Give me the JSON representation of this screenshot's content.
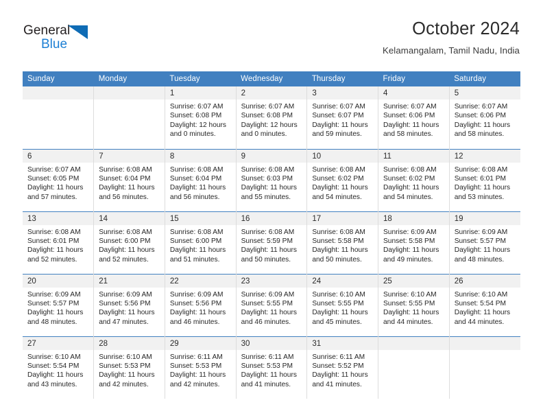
{
  "brand": {
    "name_top": "General",
    "name_bottom": "Blue",
    "triangle_color": "#0f6cb5",
    "text_color": "#1c7fd4"
  },
  "header": {
    "title": "October 2024",
    "subtitle": "Kelamangalam, Tamil Nadu, India"
  },
  "theme": {
    "header_blue": "#4180c0",
    "daynum_band": "#f1f1f1",
    "grid_line": "#dcdcdc"
  },
  "weekdays": [
    "Sunday",
    "Monday",
    "Tuesday",
    "Wednesday",
    "Thursday",
    "Friday",
    "Saturday"
  ],
  "weeks": [
    [
      {
        "day": "",
        "info": ""
      },
      {
        "day": "",
        "info": ""
      },
      {
        "day": "1",
        "info": "Sunrise: 6:07 AM\nSunset: 6:08 PM\nDaylight: 12 hours\nand 0 minutes."
      },
      {
        "day": "2",
        "info": "Sunrise: 6:07 AM\nSunset: 6:08 PM\nDaylight: 12 hours\nand 0 minutes."
      },
      {
        "day": "3",
        "info": "Sunrise: 6:07 AM\nSunset: 6:07 PM\nDaylight: 11 hours\nand 59 minutes."
      },
      {
        "day": "4",
        "info": "Sunrise: 6:07 AM\nSunset: 6:06 PM\nDaylight: 11 hours\nand 58 minutes."
      },
      {
        "day": "5",
        "info": "Sunrise: 6:07 AM\nSunset: 6:06 PM\nDaylight: 11 hours\nand 58 minutes."
      }
    ],
    [
      {
        "day": "6",
        "info": "Sunrise: 6:07 AM\nSunset: 6:05 PM\nDaylight: 11 hours\nand 57 minutes."
      },
      {
        "day": "7",
        "info": "Sunrise: 6:08 AM\nSunset: 6:04 PM\nDaylight: 11 hours\nand 56 minutes."
      },
      {
        "day": "8",
        "info": "Sunrise: 6:08 AM\nSunset: 6:04 PM\nDaylight: 11 hours\nand 56 minutes."
      },
      {
        "day": "9",
        "info": "Sunrise: 6:08 AM\nSunset: 6:03 PM\nDaylight: 11 hours\nand 55 minutes."
      },
      {
        "day": "10",
        "info": "Sunrise: 6:08 AM\nSunset: 6:02 PM\nDaylight: 11 hours\nand 54 minutes."
      },
      {
        "day": "11",
        "info": "Sunrise: 6:08 AM\nSunset: 6:02 PM\nDaylight: 11 hours\nand 54 minutes."
      },
      {
        "day": "12",
        "info": "Sunrise: 6:08 AM\nSunset: 6:01 PM\nDaylight: 11 hours\nand 53 minutes."
      }
    ],
    [
      {
        "day": "13",
        "info": "Sunrise: 6:08 AM\nSunset: 6:01 PM\nDaylight: 11 hours\nand 52 minutes."
      },
      {
        "day": "14",
        "info": "Sunrise: 6:08 AM\nSunset: 6:00 PM\nDaylight: 11 hours\nand 52 minutes."
      },
      {
        "day": "15",
        "info": "Sunrise: 6:08 AM\nSunset: 6:00 PM\nDaylight: 11 hours\nand 51 minutes."
      },
      {
        "day": "16",
        "info": "Sunrise: 6:08 AM\nSunset: 5:59 PM\nDaylight: 11 hours\nand 50 minutes."
      },
      {
        "day": "17",
        "info": "Sunrise: 6:08 AM\nSunset: 5:58 PM\nDaylight: 11 hours\nand 50 minutes."
      },
      {
        "day": "18",
        "info": "Sunrise: 6:09 AM\nSunset: 5:58 PM\nDaylight: 11 hours\nand 49 minutes."
      },
      {
        "day": "19",
        "info": "Sunrise: 6:09 AM\nSunset: 5:57 PM\nDaylight: 11 hours\nand 48 minutes."
      }
    ],
    [
      {
        "day": "20",
        "info": "Sunrise: 6:09 AM\nSunset: 5:57 PM\nDaylight: 11 hours\nand 48 minutes."
      },
      {
        "day": "21",
        "info": "Sunrise: 6:09 AM\nSunset: 5:56 PM\nDaylight: 11 hours\nand 47 minutes."
      },
      {
        "day": "22",
        "info": "Sunrise: 6:09 AM\nSunset: 5:56 PM\nDaylight: 11 hours\nand 46 minutes."
      },
      {
        "day": "23",
        "info": "Sunrise: 6:09 AM\nSunset: 5:55 PM\nDaylight: 11 hours\nand 46 minutes."
      },
      {
        "day": "24",
        "info": "Sunrise: 6:10 AM\nSunset: 5:55 PM\nDaylight: 11 hours\nand 45 minutes."
      },
      {
        "day": "25",
        "info": "Sunrise: 6:10 AM\nSunset: 5:55 PM\nDaylight: 11 hours\nand 44 minutes."
      },
      {
        "day": "26",
        "info": "Sunrise: 6:10 AM\nSunset: 5:54 PM\nDaylight: 11 hours\nand 44 minutes."
      }
    ],
    [
      {
        "day": "27",
        "info": "Sunrise: 6:10 AM\nSunset: 5:54 PM\nDaylight: 11 hours\nand 43 minutes."
      },
      {
        "day": "28",
        "info": "Sunrise: 6:10 AM\nSunset: 5:53 PM\nDaylight: 11 hours\nand 42 minutes."
      },
      {
        "day": "29",
        "info": "Sunrise: 6:11 AM\nSunset: 5:53 PM\nDaylight: 11 hours\nand 42 minutes."
      },
      {
        "day": "30",
        "info": "Sunrise: 6:11 AM\nSunset: 5:53 PM\nDaylight: 11 hours\nand 41 minutes."
      },
      {
        "day": "31",
        "info": "Sunrise: 6:11 AM\nSunset: 5:52 PM\nDaylight: 11 hours\nand 41 minutes."
      },
      {
        "day": "",
        "info": ""
      },
      {
        "day": "",
        "info": ""
      }
    ]
  ]
}
